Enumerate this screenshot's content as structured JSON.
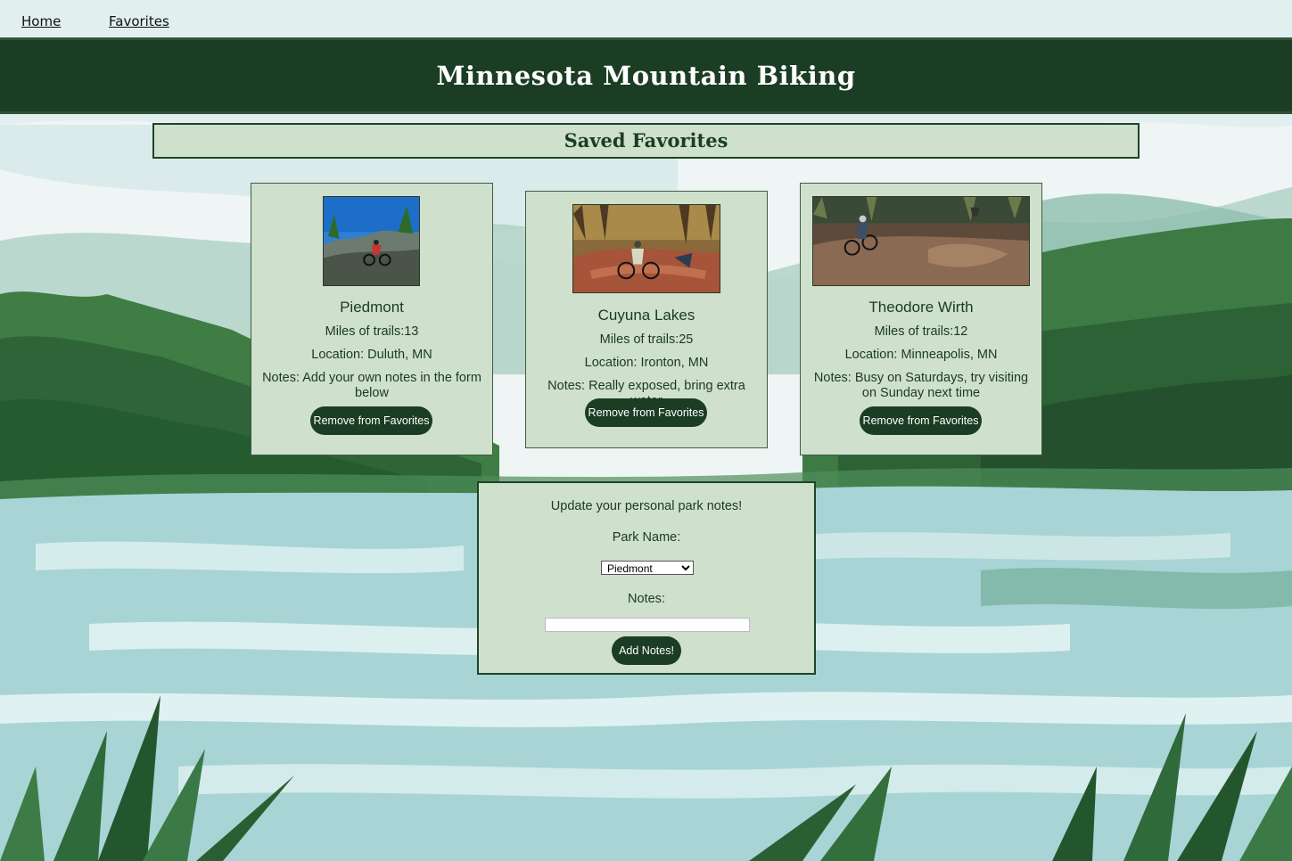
{
  "nav": {
    "home_label": "Home",
    "favorites_label": "Favorites"
  },
  "header": {
    "title": "Minnesota Mountain Biking"
  },
  "section": {
    "title": "Saved Favorites"
  },
  "parks": [
    {
      "name": "Piedmont",
      "miles": "Miles of trails:13",
      "location": "Location: Duluth, MN",
      "notes": "Notes: Add your own notes in the form below",
      "button": "Remove from Favorites"
    },
    {
      "name": "Cuyuna Lakes",
      "miles": "Miles of trails:25",
      "location": "Location: Ironton, MN",
      "notes": "Notes: Really exposed, bring extra water",
      "button": "Remove from Favorites"
    },
    {
      "name": "Theodore Wirth",
      "miles": "Miles of trails:12",
      "location": "Location: Minneapolis, MN",
      "notes": "Notes: Busy on Saturdays, try visiting on Sunday next time",
      "button": "Remove from Favorites"
    }
  ],
  "form": {
    "heading": "Update your personal park notes!",
    "park_label": "Park Name:",
    "park_selected": "Piedmont",
    "notes_label": "Notes:",
    "notes_value": "",
    "submit_label": "Add Notes!"
  },
  "colors": {
    "brand_dark": "#1b3d23",
    "panel": "#cfe0cc"
  }
}
